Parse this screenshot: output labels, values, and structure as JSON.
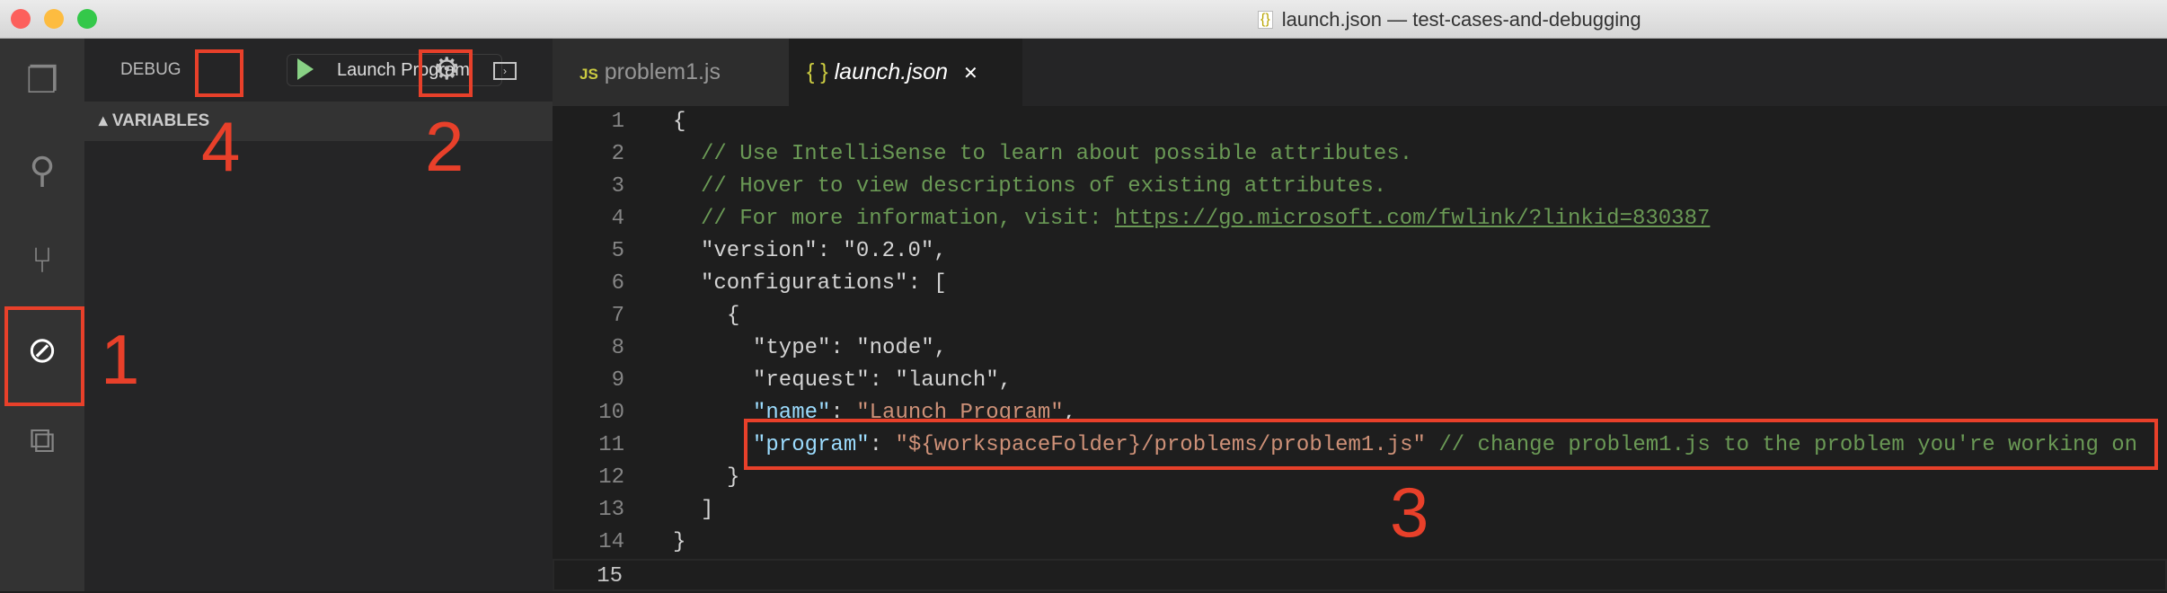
{
  "window": {
    "title": "launch.json — test-cases-and-debugging"
  },
  "activity_bar": [
    "explorer-icon",
    "search-icon",
    "source-control-icon",
    "debug-icon",
    "extensions-icon"
  ],
  "debug": {
    "label": "DEBUG",
    "config": "Launch Program",
    "variables": "VARIABLES"
  },
  "tabs": [
    {
      "icon": "JS",
      "label": "problem1.js"
    },
    {
      "icon": "{ }",
      "label": "launch.json",
      "close": "✕"
    }
  ],
  "code": {
    "l2": "// Use IntelliSense to learn about possible attributes.",
    "l3": "// Hover to view descriptions of existing attributes.",
    "l4a": "// For more information, visit: ",
    "l4b": "https://go.microsoft.com/fwlink/?linkid=830387",
    "l5": "\"version\": \"0.2.0\",",
    "l6": "\"configurations\": [",
    "l8": "\"type\": \"node\",",
    "l9": "\"request\": \"launch\",",
    "l10k": "\"name\"",
    "l10v": "\"Launch Program\"",
    "l11k": "\"program\"",
    "l11v": "\"${workspaceFolder}/problems/problem1.js\"",
    "l11c": "// change problem1.js to the problem you're working on"
  },
  "annotations": [
    "1",
    "2",
    "3",
    "4"
  ],
  "colors": {
    "annotation": "#e8402a",
    "comment": "#6a9955",
    "key": "#9cdcfe",
    "string": "#ce9178"
  }
}
